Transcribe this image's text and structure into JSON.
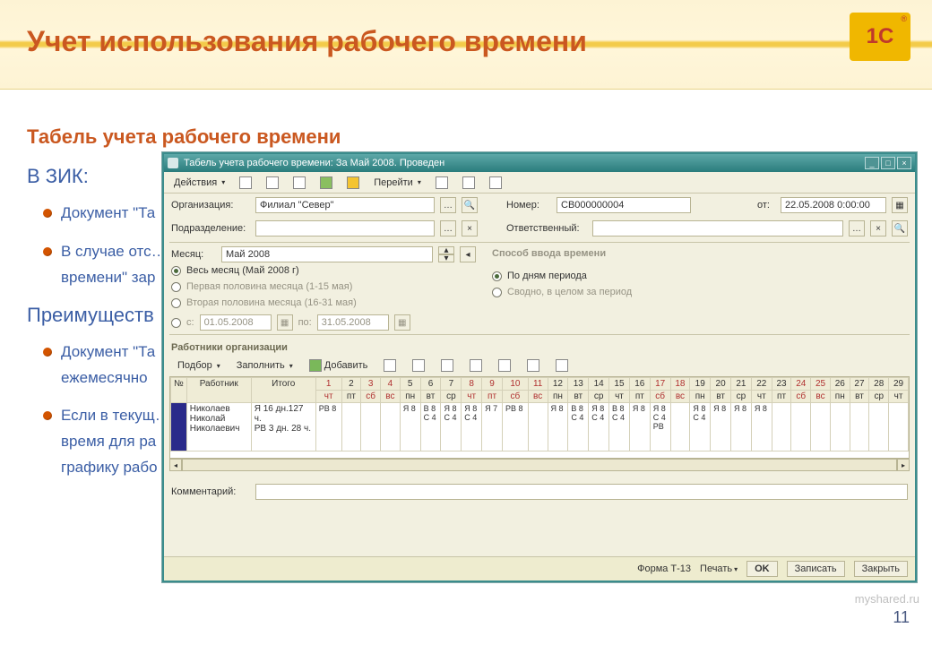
{
  "slide": {
    "title": "Учет использования рабочего времени",
    "subtitle": "Табель учета рабочего времени",
    "zik_heading": "В ЗИК:",
    "bullets": [
      "Документ \"Та",
      "В случае отс…\nвремени\" зар"
    ],
    "advantages_heading": "Преимуществ",
    "adv_bullets": [
      "Документ \"Та\nежемесячно",
      "Если в текущ…\nвремя для ра\nграфику рабо"
    ],
    "page_number": "11",
    "watermark": "myshared.ru"
  },
  "window": {
    "title": "Табель учета рабочего времени: За Май 2008. Проведен",
    "toolbar": {
      "actions": "Действия",
      "goto": "Перейти"
    },
    "fields": {
      "org_label": "Организация:",
      "org_value": "Филиал \"Север\"",
      "number_label": "Номер:",
      "number_value": "СВ000000004",
      "date_label": "от:",
      "date_value": "22.05.2008 0:00:00",
      "dept_label": "Подразделение:",
      "dept_value": "",
      "resp_label": "Ответственный:",
      "resp_value": ""
    },
    "month": {
      "label": "Месяц:",
      "value": "Май 2008",
      "opt_full": "Весь месяц (Май 2008 г)",
      "opt_first": "Первая половина месяца (1-15 мая)",
      "opt_second": "Вторая половина месяца (16-31 мая)",
      "opt_range": "с:",
      "from": "01.05.2008",
      "to_label": "по:",
      "to": "31.05.2008",
      "mode_title": "Способ ввода времени",
      "mode_days": "По дням периода",
      "mode_summary": "Сводно, в целом за период"
    },
    "employees": {
      "title": "Работники организации",
      "tb": {
        "pick": "Подбор",
        "fill": "Заполнить",
        "add": "Добавить"
      }
    },
    "grid": {
      "cols": {
        "num": "№",
        "employee": "Работник",
        "total": "Итого"
      },
      "days": [
        {
          "n": "1",
          "w": "чт",
          "red": true
        },
        {
          "n": "2",
          "w": "пт"
        },
        {
          "n": "3",
          "w": "сб",
          "red": true
        },
        {
          "n": "4",
          "w": "вс",
          "red": true
        },
        {
          "n": "5",
          "w": "пн"
        },
        {
          "n": "6",
          "w": "вт"
        },
        {
          "n": "7",
          "w": "ср"
        },
        {
          "n": "8",
          "w": "чт",
          "red": true
        },
        {
          "n": "9",
          "w": "пт",
          "red": true
        },
        {
          "n": "10",
          "w": "сб",
          "red": true
        },
        {
          "n": "11",
          "w": "вс",
          "red": true
        },
        {
          "n": "12",
          "w": "пн"
        },
        {
          "n": "13",
          "w": "вт"
        },
        {
          "n": "14",
          "w": "ср"
        },
        {
          "n": "15",
          "w": "чт"
        },
        {
          "n": "16",
          "w": "пт"
        },
        {
          "n": "17",
          "w": "сб",
          "red": true
        },
        {
          "n": "18",
          "w": "вс",
          "red": true
        },
        {
          "n": "19",
          "w": "пн"
        },
        {
          "n": "20",
          "w": "вт"
        },
        {
          "n": "21",
          "w": "ср"
        },
        {
          "n": "22",
          "w": "чт"
        },
        {
          "n": "23",
          "w": "пт"
        },
        {
          "n": "24",
          "w": "сб",
          "red": true
        },
        {
          "n": "25",
          "w": "вс",
          "red": true
        },
        {
          "n": "26",
          "w": "пн"
        },
        {
          "n": "27",
          "w": "вт"
        },
        {
          "n": "28",
          "w": "ср"
        },
        {
          "n": "29",
          "w": "чт"
        }
      ],
      "row": {
        "num": "1",
        "name": "Николаев\nНиколай\nНиколаевич",
        "total": "Я 16 дн.127 ч.\nРВ 3 дн. 28 ч.",
        "cells": [
          "РВ 8",
          "",
          "",
          "",
          "Я 8",
          "В 8\nС 4",
          "Я 8\nС 4",
          "Я 8\nС 4",
          "Я 7",
          "РВ 8",
          "",
          "Я 8",
          "В 8\nС 4",
          "Я 8\nС 4",
          "В 8\nС 4",
          "Я 8",
          "Я 8\nС 4\nРВ",
          "",
          "Я 8\nС 4",
          "Я 8",
          "Я 8",
          "Я 8",
          "",
          "",
          "",
          "",
          "",
          "",
          ""
        ]
      }
    },
    "comment_label": "Комментарий:",
    "footer": {
      "form": "Форма Т-13",
      "print": "Печать",
      "ok": "OK",
      "save": "Записать",
      "close": "Закрыть"
    }
  }
}
